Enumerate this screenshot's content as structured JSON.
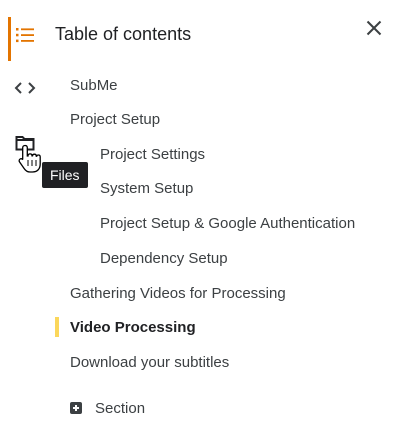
{
  "panel": {
    "title": "Table of contents"
  },
  "rail": {
    "items": [
      {
        "icon": "list-icon"
      },
      {
        "icon": "code-icon"
      },
      {
        "icon": "folder-icon"
      }
    ],
    "tooltip": "Files"
  },
  "toc": {
    "items": [
      {
        "label": "SubMe",
        "level": 1
      },
      {
        "label": "Project Setup",
        "level": 1
      },
      {
        "label": "Project Settings",
        "level": 2
      },
      {
        "label": "System Setup",
        "level": 2
      },
      {
        "label": "Project Setup & Google Authentication",
        "level": 2
      },
      {
        "label": "Dependency Setup",
        "level": 2
      },
      {
        "label": "Gathering Videos for Processing",
        "level": 1
      },
      {
        "label": "Video Processing",
        "level": 1,
        "current": true
      },
      {
        "label": "Download your subtitles",
        "level": 1
      }
    ],
    "add_section_label": "Section"
  },
  "colors": {
    "accent": "#e37400",
    "current_marker": "#fbd75b",
    "tooltip_bg": "#202124"
  }
}
